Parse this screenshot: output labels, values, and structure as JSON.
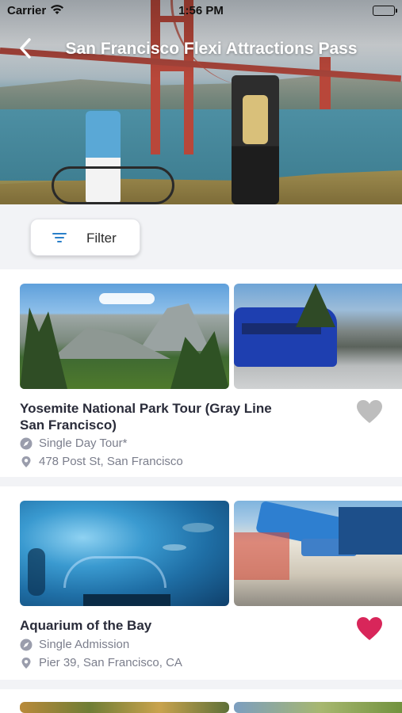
{
  "status_bar": {
    "carrier": "Carrier",
    "time": "1:56 PM"
  },
  "nav": {
    "title": "San Francisco Flexi Attractions Pass",
    "back_icon": "chevron-left-icon"
  },
  "filter": {
    "label": "Filter",
    "icon": "filter-icon",
    "accent": "#2a7fc9"
  },
  "cards": [
    {
      "name": "Yosemite National Park Tour (Gray Line San Francisco)",
      "type": "Single Day Tour*",
      "address": "478 Post St, San Francisco",
      "favorite": false,
      "heart_color": "#bdbdbd"
    },
    {
      "name": "Aquarium of the Bay",
      "type": "Single Admission",
      "address": "Pier 39, San Francisco, CA",
      "favorite": true,
      "heart_color": "#d8265a"
    }
  ]
}
